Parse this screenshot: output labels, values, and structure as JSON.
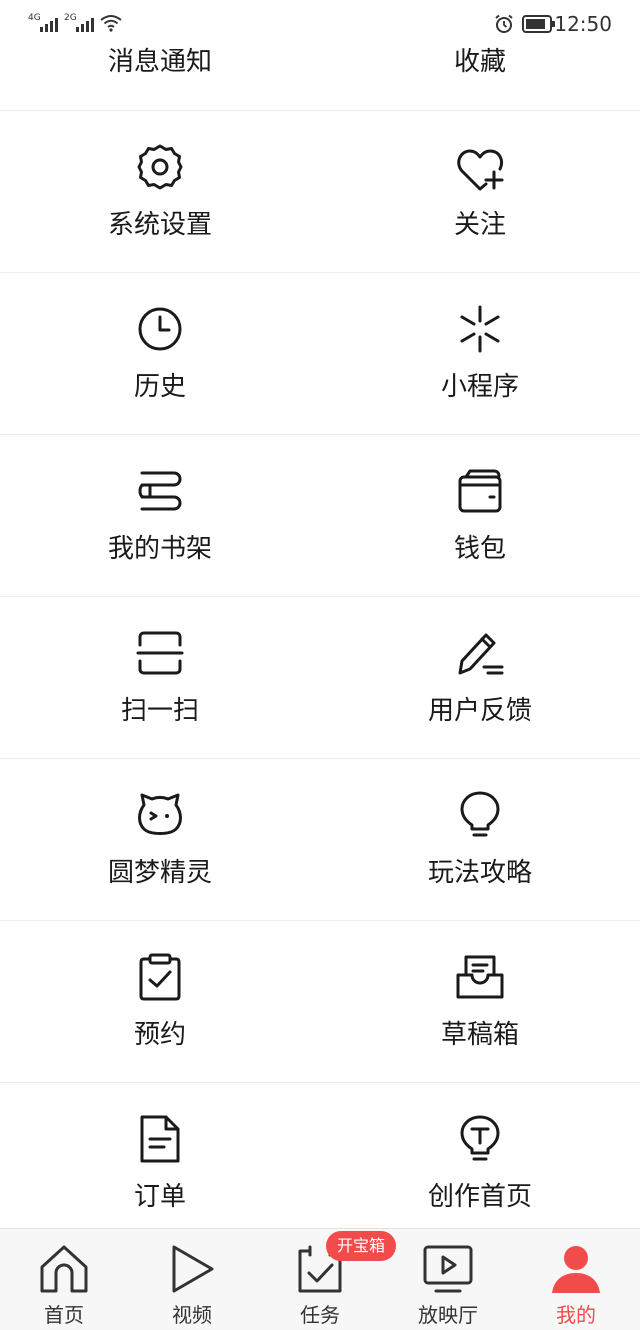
{
  "status_bar": {
    "signal_1": "4G",
    "signal_2": "2G",
    "time": "12:50",
    "icons": [
      "wifi-icon",
      "alarm-icon",
      "battery-icon"
    ]
  },
  "grid": {
    "top_row": {
      "left": "消息通知",
      "right": "收藏"
    },
    "items": [
      {
        "label": "系统设置",
        "icon": "gear-icon"
      },
      {
        "label": "关注",
        "icon": "heart-plus-icon"
      },
      {
        "label": "历史",
        "icon": "clock-icon"
      },
      {
        "label": "小程序",
        "icon": "mini-program-icon"
      },
      {
        "label": "我的书架",
        "icon": "bookshelf-icon"
      },
      {
        "label": "钱包",
        "icon": "wallet-icon"
      },
      {
        "label": "扫一扫",
        "icon": "scan-icon"
      },
      {
        "label": "用户反馈",
        "icon": "pencil-feedback-icon"
      },
      {
        "label": "圆梦精灵",
        "icon": "sprite-face-icon"
      },
      {
        "label": "玩法攻略",
        "icon": "lightbulb-icon"
      },
      {
        "label": "预约",
        "icon": "clipboard-check-icon"
      },
      {
        "label": "草稿箱",
        "icon": "inbox-icon"
      },
      {
        "label": "订单",
        "icon": "document-icon"
      },
      {
        "label": "创作首页",
        "icon": "bulb-t-icon"
      }
    ]
  },
  "bottom_nav": {
    "items": [
      {
        "label": "首页",
        "icon": "home-icon"
      },
      {
        "label": "视频",
        "icon": "play-icon"
      },
      {
        "label": "任务",
        "icon": "task-icon"
      },
      {
        "label": "放映厅",
        "icon": "screen-icon"
      },
      {
        "label": "我的",
        "icon": "user-icon",
        "active": true
      }
    ],
    "badge": "开宝箱"
  },
  "colors": {
    "accent": "#f24b4b",
    "icon_stroke": "#1a1a1a",
    "divider": "#ececec"
  }
}
